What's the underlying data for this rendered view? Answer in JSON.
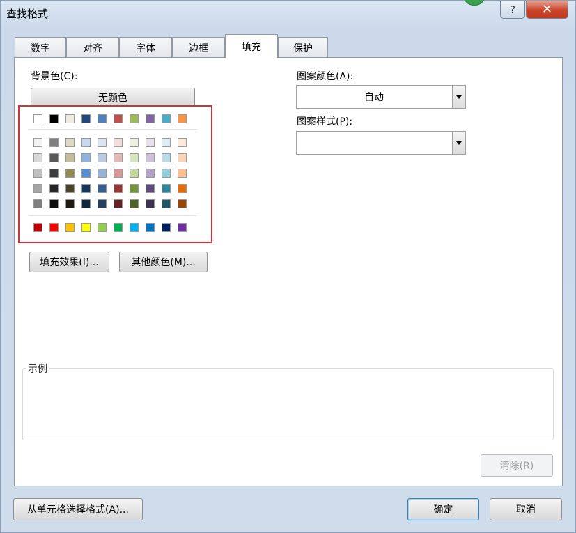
{
  "window": {
    "title": "查找格式",
    "help_glyph": "?",
    "close_glyph": "✕"
  },
  "tabs": [
    {
      "label": "数字",
      "active": false
    },
    {
      "label": "对齐",
      "active": false
    },
    {
      "label": "字体",
      "active": false
    },
    {
      "label": "边框",
      "active": false
    },
    {
      "label": "填充",
      "active": true
    },
    {
      "label": "保护",
      "active": false
    }
  ],
  "fill": {
    "background_color_label": "背景色(C):",
    "no_color_button": "无颜色",
    "pattern_color_label": "图案颜色(A):",
    "pattern_color_value": "自动",
    "pattern_style_label": "图案样式(P):",
    "pattern_style_value": "",
    "fill_effects_button": "填充效果(I)...",
    "more_colors_button": "其他颜色(M)...",
    "sample_label": "示例",
    "clear_button": "清除(R)",
    "palette": {
      "theme_row": [
        "#ffffff",
        "#000000",
        "#eeece1",
        "#1f497d",
        "#4f81bd",
        "#c0504d",
        "#9bbb59",
        "#8064a2",
        "#4bacc6",
        "#f79646"
      ],
      "tint_rows": [
        [
          "#f2f2f2",
          "#7f7f7f",
          "#ddd9c3",
          "#c6d9f0",
          "#dbe5f1",
          "#f2dcdb",
          "#ebf1dd",
          "#e5e0ec",
          "#dbeef3",
          "#fdeada"
        ],
        [
          "#d8d8d8",
          "#595959",
          "#c4bd97",
          "#8db3e2",
          "#b8cce4",
          "#e5b9b7",
          "#d7e3bc",
          "#ccc1d9",
          "#b7dde8",
          "#fbd5b5"
        ],
        [
          "#bfbfbf",
          "#3f3f3f",
          "#938953",
          "#548dd4",
          "#95b3d7",
          "#d99694",
          "#c3d69b",
          "#b2a2c7",
          "#92cddc",
          "#fac08f"
        ],
        [
          "#a5a5a5",
          "#262626",
          "#494429",
          "#17365d",
          "#366092",
          "#953734",
          "#76923c",
          "#5f497a",
          "#31859b",
          "#e36c09"
        ],
        [
          "#7f7f7f",
          "#0c0c0c",
          "#1d1b10",
          "#0f243e",
          "#244061",
          "#632423",
          "#4f6128",
          "#3f3151",
          "#205867",
          "#974806"
        ]
      ],
      "standard_row": [
        "#c00000",
        "#ff0000",
        "#ffc000",
        "#ffff00",
        "#92d050",
        "#00b050",
        "#00b0f0",
        "#0070c0",
        "#002060",
        "#7030a0"
      ],
      "highlight_color": "#d0343b"
    }
  },
  "footer": {
    "select_from_cell_button": "从单元格选择格式(A)...",
    "ok_button": "确定",
    "cancel_button": "取消"
  }
}
